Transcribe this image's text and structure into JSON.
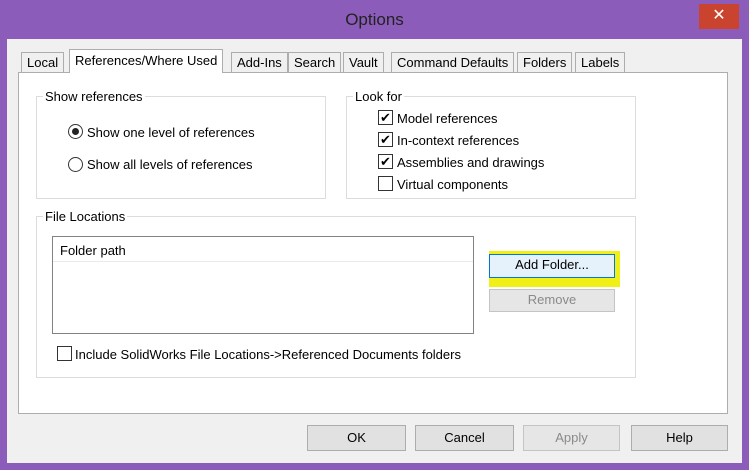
{
  "window": {
    "title": "Options",
    "close_symbol": "✕"
  },
  "tabs": [
    {
      "label": "Local",
      "active": false
    },
    {
      "label": "References/Where Used",
      "active": true
    },
    {
      "label": "Add-Ins",
      "active": false
    },
    {
      "label": "Search",
      "active": false
    },
    {
      "label": "Vault",
      "active": false
    },
    {
      "label": "Command Defaults",
      "active": false
    },
    {
      "label": "Folders",
      "active": false
    },
    {
      "label": "Labels",
      "active": false
    }
  ],
  "show_references": {
    "title": "Show references",
    "options": [
      {
        "label": "Show one level of references",
        "selected": true
      },
      {
        "label": "Show all levels of references",
        "selected": false
      }
    ]
  },
  "look_for": {
    "title": "Look for",
    "items": [
      {
        "label": "Model references",
        "checked": true,
        "mark": "✔"
      },
      {
        "label": "In-context references",
        "checked": true,
        "mark": "✔"
      },
      {
        "label": "Assemblies and drawings",
        "checked": true,
        "mark": "✔"
      },
      {
        "label": "Virtual components",
        "checked": false,
        "mark": ""
      }
    ]
  },
  "file_locations": {
    "title": "File Locations",
    "column_header": "Folder path",
    "add_button": "Add Folder...",
    "remove_button": "Remove",
    "include_label": "Include SolidWorks File Locations->Referenced Documents folders",
    "include_checked": false
  },
  "footer": {
    "ok": "OK",
    "cancel": "Cancel",
    "apply": "Apply",
    "help": "Help"
  },
  "colors": {
    "window_frame": "#8c5cba",
    "close_button": "#c9432f",
    "highlight": "#f0f017"
  }
}
